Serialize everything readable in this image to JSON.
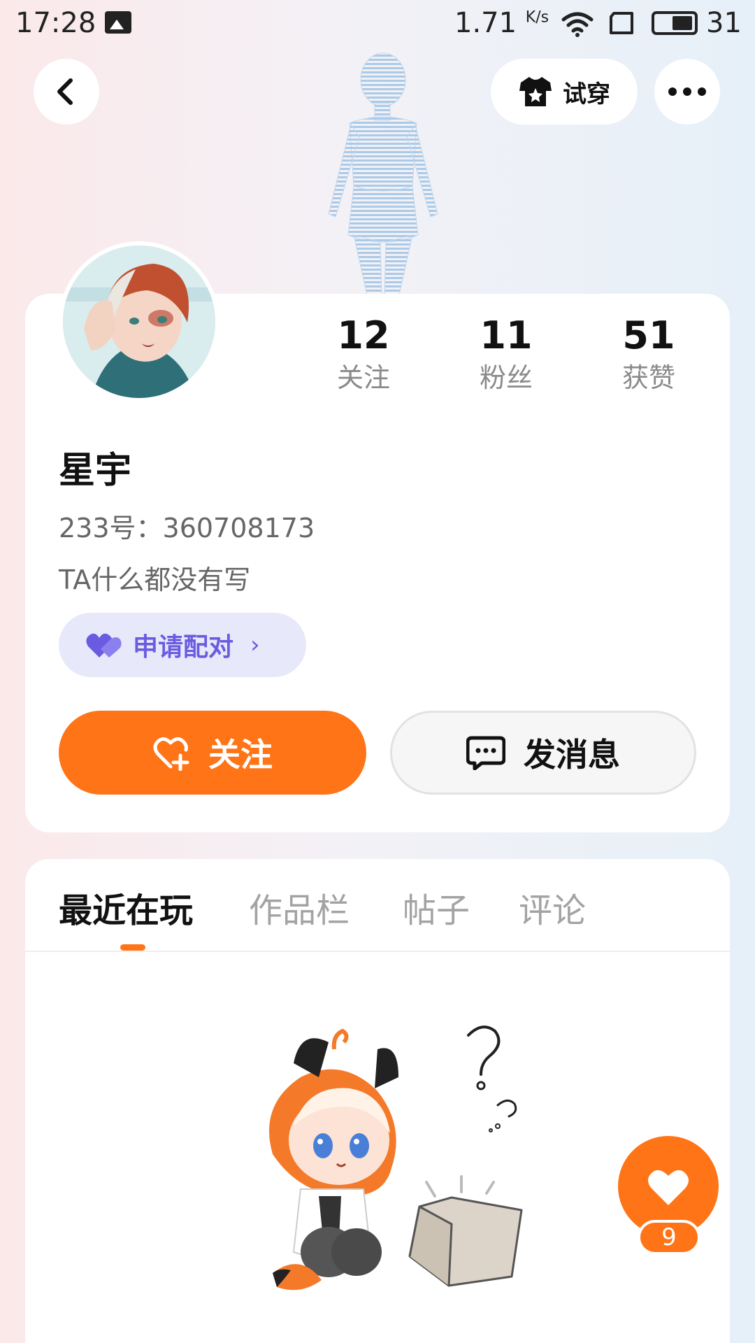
{
  "status_bar": {
    "time": "17:28",
    "net_speed": "1.71",
    "net_unit": "K/s",
    "battery": "31",
    "icons": [
      "image-icon",
      "wifi-icon",
      "sim-icon",
      "battery-icon"
    ]
  },
  "header": {
    "try_on_label": "试穿",
    "icons": [
      "back-icon",
      "tshirt-icon",
      "more-icon"
    ]
  },
  "profile": {
    "name": "星宇",
    "uid": "233号：360708173",
    "bio": "TA什么都没有写",
    "stats": [
      {
        "value": "12",
        "label": "关注"
      },
      {
        "value": "11",
        "label": "粉丝"
      },
      {
        "value": "51",
        "label": "获赞"
      }
    ],
    "pair_label": "申请配对",
    "follow_label": "关注",
    "message_label": "发消息"
  },
  "tabs": [
    {
      "label": "最近在玩",
      "active": true
    },
    {
      "label": "作品栏",
      "active": false
    },
    {
      "label": "帖子",
      "active": false
    },
    {
      "label": "评论",
      "active": false
    }
  ],
  "like_count": "9",
  "colors": {
    "accent": "#ff7416",
    "pair_bg": "#e8e8fb",
    "pair_text": "#6a5ce0"
  }
}
